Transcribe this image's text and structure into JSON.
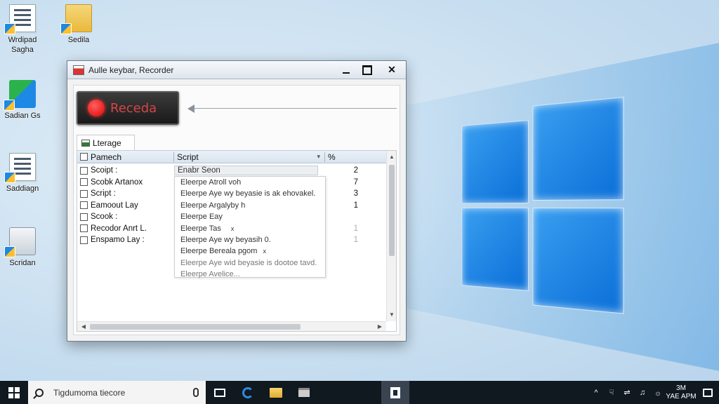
{
  "desktop": {
    "icons": [
      {
        "label": "Wrdipad Sagha",
        "icon": "document-icon"
      },
      {
        "label": "Sedila",
        "icon": "folder-icon"
      },
      {
        "label": "Sadian Gs",
        "icon": "tiles-app-icon"
      },
      {
        "label": "Saddiagn",
        "icon": "document-stack-icon"
      },
      {
        "label": "Scridan",
        "icon": "box-app-icon"
      }
    ]
  },
  "window": {
    "title": "Aulle keybar, Recorder",
    "record_label": "Receda",
    "tab_label": "Lterage",
    "columns": {
      "name": "Pamech",
      "script": "Script",
      "count": "%"
    },
    "rows": [
      {
        "name": "Scoipt :",
        "script": "Enabr Seon",
        "count": "2"
      },
      {
        "name": "Scobk Artanox",
        "script": "",
        "count": "7"
      },
      {
        "name": "Script :",
        "script": "",
        "count": "3"
      },
      {
        "name": "Eamoout Lay",
        "script": "",
        "count": "1"
      },
      {
        "name": "Scook :",
        "script": "",
        "count": ""
      },
      {
        "name": "Recodor Anrt L.",
        "script": "",
        "count": "1"
      },
      {
        "name": "Enspamo Lay :",
        "script": "",
        "count": "1"
      }
    ],
    "dropdown_items": [
      "Eleerpe Atroll voh",
      "Eleerpe Aye wy beyasie is ak ehovakel.",
      "Eleerpe Argalyby h",
      "Eleerpe Eay",
      "Eleerpe Tas",
      "Eleerpe Aye wy beyasih 0.",
      "Eleerpe Bereala pgom",
      "Eleerpe Aye wid beyasie is dootoe tavd.",
      "Eleerpe Avelice..."
    ],
    "dropdown_marks": [
      "x",
      "x"
    ]
  },
  "taskbar": {
    "search_placeholder": "Tigdumoma tiecore",
    "clock_time": "3M",
    "clock_date": "YAE APM",
    "tray_icons": [
      "^",
      "☟",
      "⇌",
      "♫",
      "۞"
    ]
  },
  "colors": {
    "accent": "#0a6fd8",
    "record": "#e00000",
    "taskbar": "#101820"
  }
}
